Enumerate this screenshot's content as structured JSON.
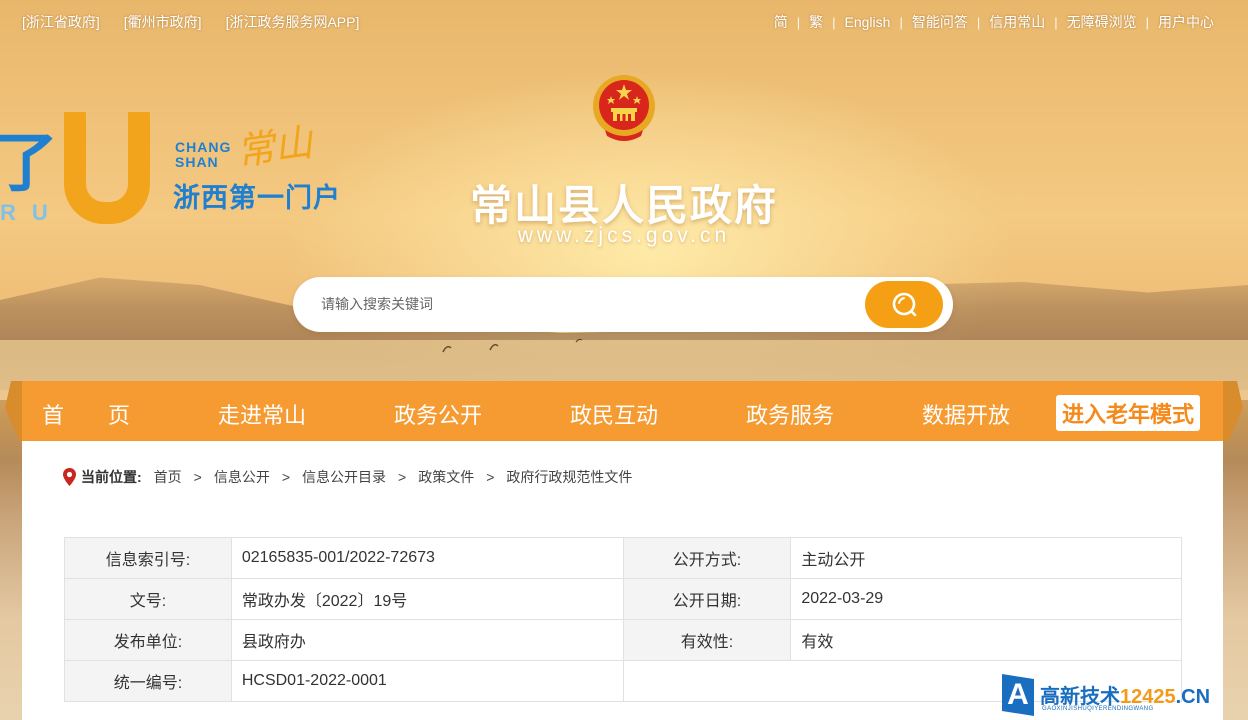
{
  "topbar": {
    "left_links": [
      "[浙江省政府]",
      "[衢州市政府]",
      "[浙江政务服务网APP]"
    ],
    "right_links": [
      "简",
      "繁",
      "English",
      "智能问答",
      "信用常山",
      "无障碍浏览",
      "用户中心"
    ]
  },
  "logo": {
    "chang": "CHANG",
    "shan": "SHAN",
    "calligraphy": "常山",
    "slogan": "浙西第一门户"
  },
  "header": {
    "title": "常山县人民政府",
    "url": "www.zjcs.gov.cn"
  },
  "search": {
    "placeholder": "请输入搜索关键词"
  },
  "nav": {
    "items": [
      "首　　页",
      "走进常山",
      "政务公开",
      "政民互动",
      "政务服务",
      "数据开放"
    ],
    "elder_mode": "进入老年模式"
  },
  "breadcrumb": {
    "label": "当前位置:",
    "items": [
      "首页",
      "信息公开",
      "信息公开目录",
      "政策文件",
      "政府行政规范性文件"
    ]
  },
  "info_table": {
    "rows": [
      {
        "k1": "信息索引号:",
        "v1": "02165835-001/2022-72673",
        "k2": "公开方式:",
        "v2": "主动公开"
      },
      {
        "k1": "文号:",
        "v1": "常政办发〔2022〕19号",
        "k2": "公开日期:",
        "v2": "2022-03-29"
      },
      {
        "k1": "发布单位:",
        "v1": "县政府办",
        "k2": "有效性:",
        "v2": "有效"
      },
      {
        "k1": "统一编号:",
        "v1": "HCSD01-2022-0001"
      }
    ]
  },
  "watermark": {
    "letter": "A",
    "brand_cn": "高新技术",
    "brand_num": "12425",
    "brand_suffix": ".CN",
    "pinyin": "GAOXINJISHUQIYERENDINGWANG"
  },
  "colors": {
    "nav": "#f59b32",
    "accent": "#f5a014",
    "logo_blue": "#1f7fd0"
  }
}
